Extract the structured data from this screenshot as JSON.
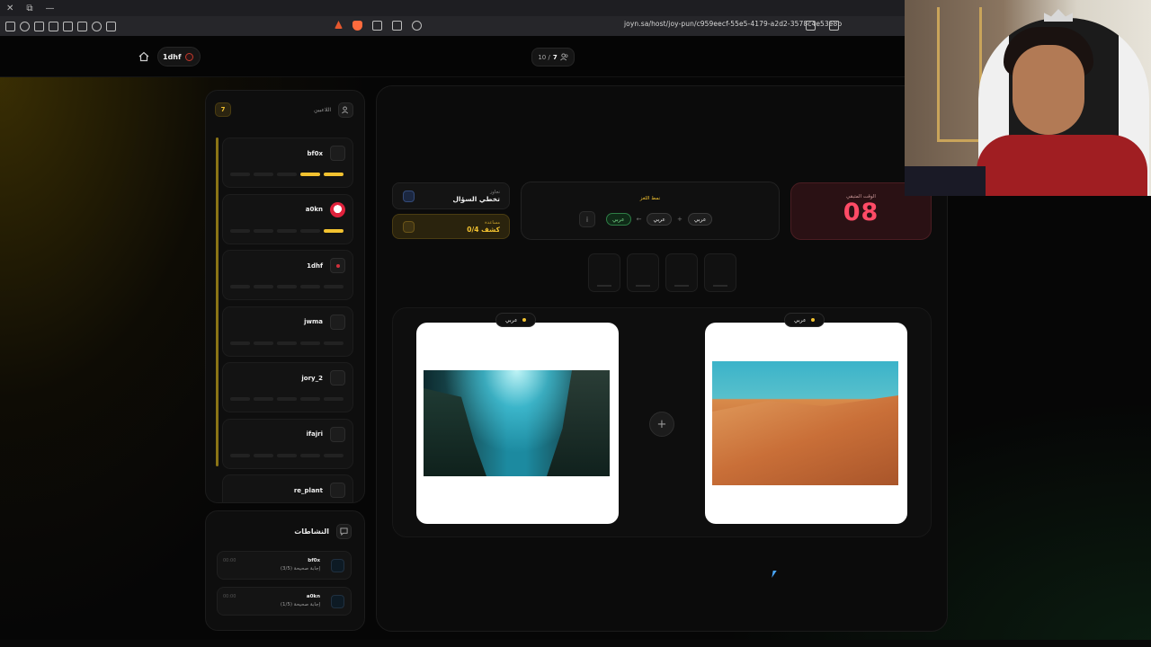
{
  "browser": {
    "url": "joyn.sa/host/joy-pun/c959eecf-55e5-4179-a2d2-3578c4e53e8b"
  },
  "header": {
    "room_name": "1dhf",
    "players_count": "7",
    "players_total": "10 /"
  },
  "players_panel": {
    "title": "اللاعبين",
    "count": "7",
    "players": [
      {
        "name": "bf0x",
        "progress": [
          0,
          0,
          0,
          1,
          1
        ]
      },
      {
        "name": "a0kn",
        "progress": [
          0,
          0,
          0,
          0,
          1
        ]
      },
      {
        "name": "1dhf",
        "progress": [
          0,
          0,
          0,
          0,
          0
        ]
      },
      {
        "name": "jwma",
        "progress": [
          0,
          0,
          0,
          0,
          0
        ]
      },
      {
        "name": "jory_2",
        "progress": [
          0,
          0,
          0,
          0,
          0
        ]
      },
      {
        "name": "ifajri",
        "progress": [
          0,
          0,
          0,
          0,
          0
        ]
      },
      {
        "name": "re_plant",
        "progress": [
          0,
          0,
          0,
          0,
          0
        ]
      }
    ]
  },
  "activity_panel": {
    "title": "النشاطات",
    "items": [
      {
        "time": "00:00",
        "name": "bf0x",
        "text": "إجابة صحيحة (3/5)"
      },
      {
        "time": "00:00",
        "name": "a0kn",
        "text": "إجابة صحيحة (1/5)"
      }
    ]
  },
  "game": {
    "skip": {
      "small": "تجاوز",
      "main": "تخطي السؤال"
    },
    "hint": {
      "small": "مساعدة",
      "main": "0/4 كشف"
    },
    "pattern": {
      "title": "نمط اللغز",
      "items": [
        "عربي",
        "+",
        "عربي",
        "←",
        "عربي"
      ]
    },
    "timer": {
      "label": "الوقت المتبقي",
      "value": "08"
    },
    "slots": 4,
    "images": [
      {
        "tag": "عربي",
        "subject": "underwater-sea"
      },
      {
        "tag": "عربي",
        "subject": "desert-dunes"
      }
    ],
    "plus": "+"
  },
  "colors": {
    "accent": "#f2c230",
    "timer": "#ff4b66",
    "correct": "#7ee08f"
  }
}
